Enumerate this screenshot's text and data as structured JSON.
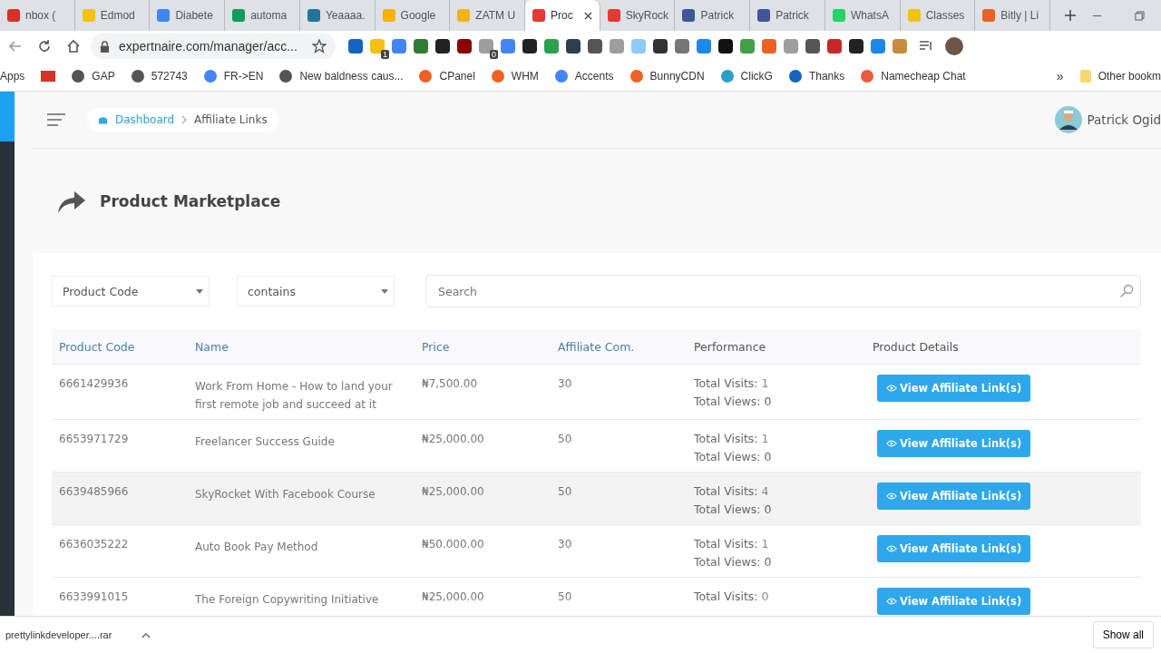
{
  "browser": {
    "tabs": [
      {
        "title": "nbox (",
        "selected": false
      },
      {
        "title": "Edmod",
        "selected": false
      },
      {
        "title": "Diabete",
        "selected": false
      },
      {
        "title": "automa",
        "selected": false
      },
      {
        "title": "Yeaaaa.",
        "selected": false
      },
      {
        "title": "Google",
        "selected": false
      },
      {
        "title": "ZATM U",
        "selected": false
      },
      {
        "title": "Proc",
        "selected": true
      },
      {
        "title": "SkyRock",
        "selected": false
      },
      {
        "title": "Patrick",
        "selected": false
      },
      {
        "title": "Patrick",
        "selected": false
      },
      {
        "title": "WhatsA",
        "selected": false
      },
      {
        "title": "Classes",
        "selected": false
      },
      {
        "title": "Bitly | Li",
        "selected": false
      }
    ],
    "address": "expertnaire.com/manager/acc...",
    "extension_badges": [
      "1",
      "0"
    ],
    "bookmarks": [
      {
        "label": "Apps"
      },
      {
        "label": "GAP"
      },
      {
        "label": "572743"
      },
      {
        "label": "FR->EN"
      },
      {
        "label": "New baldness caus..."
      },
      {
        "label": "CPanel"
      },
      {
        "label": "WHM"
      },
      {
        "label": "Accents"
      },
      {
        "label": "BunnyCDN"
      },
      {
        "label": "ClickG"
      },
      {
        "label": "Thanks"
      },
      {
        "label": "Namecheap Chat"
      }
    ],
    "more_bookmarks": "»",
    "other_bookmarks": "Other bookm"
  },
  "header": {
    "breadcrumb": [
      {
        "label": "Dashboard"
      },
      {
        "label": "Affiliate Links"
      }
    ],
    "user": "Patrick Ogid"
  },
  "page_title": "Product Marketplace",
  "filters": {
    "field": "Product Code",
    "operator": "contains",
    "search": {
      "placeholder": "Search"
    }
  },
  "table": {
    "columns": [
      "Product Code",
      "Name",
      "Price",
      "Affiliate Com.",
      "Performance",
      "Product Details"
    ],
    "rows": [
      {
        "code": "6661429936",
        "name": "Work From Home - How to land your first remote job and succeed at it",
        "price": "₦7,500.00",
        "commission": "30",
        "visits_label": "Total Visits:",
        "visits": "1",
        "views": "Total Views: 0",
        "action": "View Affiliate Link(s)",
        "hovered": false
      },
      {
        "code": "6653971729",
        "name": "Freelancer Success Guide",
        "price": "₦25,000.00",
        "commission": "50",
        "visits_label": "Total Visits:",
        "visits": "1",
        "views": "Total Views: 0",
        "action": "View Affiliate Link(s)",
        "hovered": false
      },
      {
        "code": "6639485966",
        "name": "SkyRocket With Facebook Course",
        "price": "₦25,000.00",
        "commission": "50",
        "visits_label": "Total Visits:",
        "visits": "4",
        "views": "Total Views: 0",
        "action": "View Affiliate Link(s)",
        "hovered": true
      },
      {
        "code": "6636035222",
        "name": "Auto Book Pay Method",
        "price": "₦50.000.00",
        "commission": "30",
        "visits_label": "Total Visits:",
        "visits": "1",
        "views": "Total Views: 0",
        "action": "View Affiliate Link(s)",
        "hovered": false
      },
      {
        "code": "6633991015",
        "name": "The Foreign Copywriting Initiative",
        "price": "₦25,000.00",
        "commission": "50",
        "visits_label": "Total Visits:",
        "visits": "0",
        "action": "View Affiliate Link(s)",
        "hovered": false
      }
    ]
  },
  "download_bar": {
    "file": "prettylinkdeveloper....rar",
    "button": "Show all"
  }
}
